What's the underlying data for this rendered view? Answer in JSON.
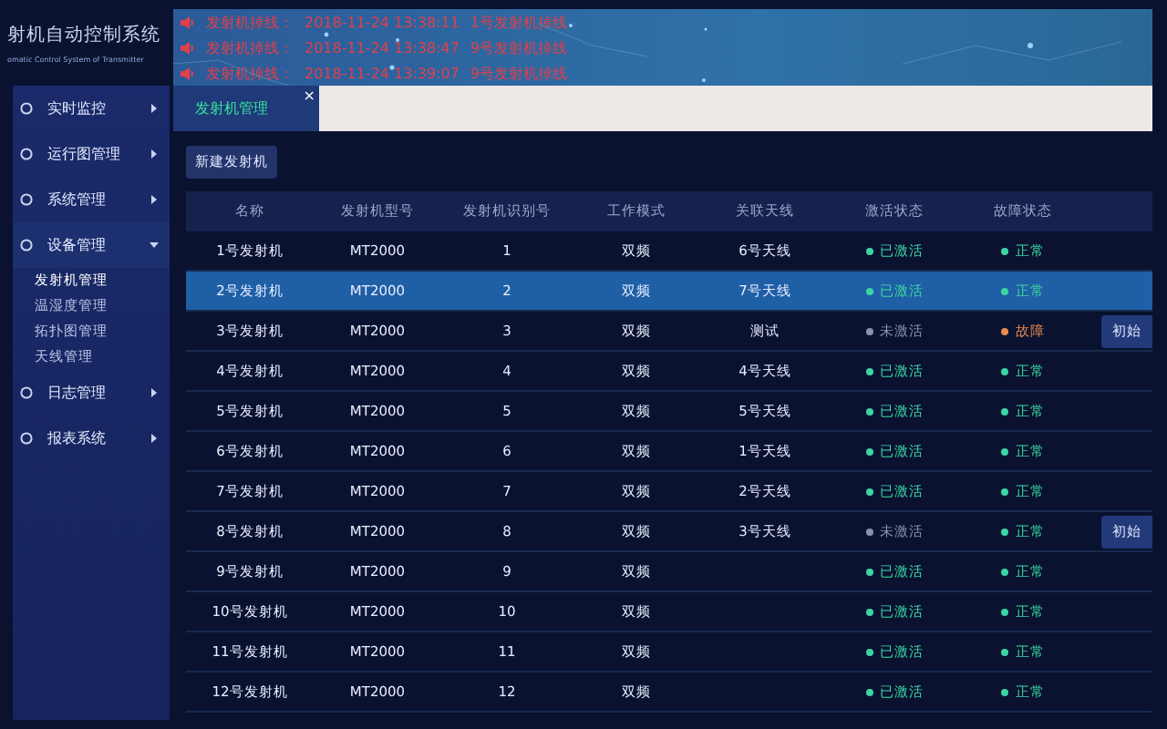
{
  "app": {
    "title": "射机自动控制系统",
    "subtitle": "omatic Control System of Transmitter"
  },
  "alarms": [
    {
      "label": "发射机掉线：",
      "time": "2018-11-24 13:38:11",
      "message": "1号发射机掉线"
    },
    {
      "label": "发射机掉线：",
      "time": "2018-11-24 13:38:47",
      "message": "9号发射机掉线"
    },
    {
      "label": "发射机掉线：",
      "time": "2018-11-24 13:39:07",
      "message": "9号发射机掉线"
    }
  ],
  "sidebar": {
    "items": [
      {
        "label": "实时监控",
        "expanded": false
      },
      {
        "label": "运行图管理",
        "expanded": false
      },
      {
        "label": "系统管理",
        "expanded": false
      },
      {
        "label": "设备管理",
        "expanded": true,
        "children": [
          {
            "label": "发射机管理",
            "selected": true
          },
          {
            "label": "温湿度管理",
            "selected": false
          },
          {
            "label": "拓扑图管理",
            "selected": false
          },
          {
            "label": "天线管理",
            "selected": false
          }
        ]
      },
      {
        "label": "日志管理",
        "expanded": false
      },
      {
        "label": "报表系统",
        "expanded": false
      }
    ]
  },
  "tabs": [
    {
      "label": "发射机管理",
      "selected": true,
      "close": "×"
    }
  ],
  "toolbar": {
    "new_button": "新建发射机"
  },
  "table": {
    "columns": [
      "名称",
      "发射机型号",
      "发射机识别号",
      "工作模式",
      "关联天线",
      "激活状态",
      "故障状态"
    ],
    "rows": [
      {
        "cells": [
          "1号发射机",
          "MT2000",
          "1",
          "双频",
          "6号天线"
        ],
        "active": true,
        "active_text": "已激活",
        "fault": false,
        "fault_text": "正常",
        "selected": false
      },
      {
        "cells": [
          "2号发射机",
          "MT2000",
          "2",
          "双频",
          "7号天线"
        ],
        "active": true,
        "active_text": "已激活",
        "fault": false,
        "fault_text": "正常",
        "selected": true
      },
      {
        "cells": [
          "3号发射机",
          "MT2000",
          "3",
          "双频",
          "测试"
        ],
        "active": false,
        "active_text": "未激活",
        "fault": true,
        "fault_text": "故障",
        "selected": false,
        "action": "初始"
      },
      {
        "cells": [
          "4号发射机",
          "MT2000",
          "4",
          "双频",
          "4号天线"
        ],
        "active": true,
        "active_text": "已激活",
        "fault": false,
        "fault_text": "正常",
        "selected": false
      },
      {
        "cells": [
          "5号发射机",
          "MT2000",
          "5",
          "双频",
          "5号天线"
        ],
        "active": true,
        "active_text": "已激活",
        "fault": false,
        "fault_text": "正常",
        "selected": false
      },
      {
        "cells": [
          "6号发射机",
          "MT2000",
          "6",
          "双频",
          "1号天线"
        ],
        "active": true,
        "active_text": "已激活",
        "fault": false,
        "fault_text": "正常",
        "selected": false
      },
      {
        "cells": [
          "7号发射机",
          "MT2000",
          "7",
          "双频",
          "2号天线"
        ],
        "active": true,
        "active_text": "已激活",
        "fault": false,
        "fault_text": "正常",
        "selected": false
      },
      {
        "cells": [
          "8号发射机",
          "MT2000",
          "8",
          "双频",
          "3号天线"
        ],
        "active": false,
        "active_text": "未激活",
        "fault": false,
        "fault_text": "正常",
        "selected": false,
        "action": "初始"
      },
      {
        "cells": [
          "9号发射机",
          "MT2000",
          "9",
          "双频",
          ""
        ],
        "active": true,
        "active_text": "已激活",
        "fault": false,
        "fault_text": "正常",
        "selected": false
      },
      {
        "cells": [
          "10号发射机",
          "MT2000",
          "10",
          "双频",
          ""
        ],
        "active": true,
        "active_text": "已激活",
        "fault": false,
        "fault_text": "正常",
        "selected": false
      },
      {
        "cells": [
          "11号发射机",
          "MT2000",
          "11",
          "双频",
          ""
        ],
        "active": true,
        "active_text": "已激活",
        "fault": false,
        "fault_text": "正常",
        "selected": false
      },
      {
        "cells": [
          "12号发射机",
          "MT2000",
          "12",
          "双频",
          ""
        ],
        "active": true,
        "active_text": "已激活",
        "fault": false,
        "fault_text": "正常",
        "selected": false
      }
    ]
  }
}
